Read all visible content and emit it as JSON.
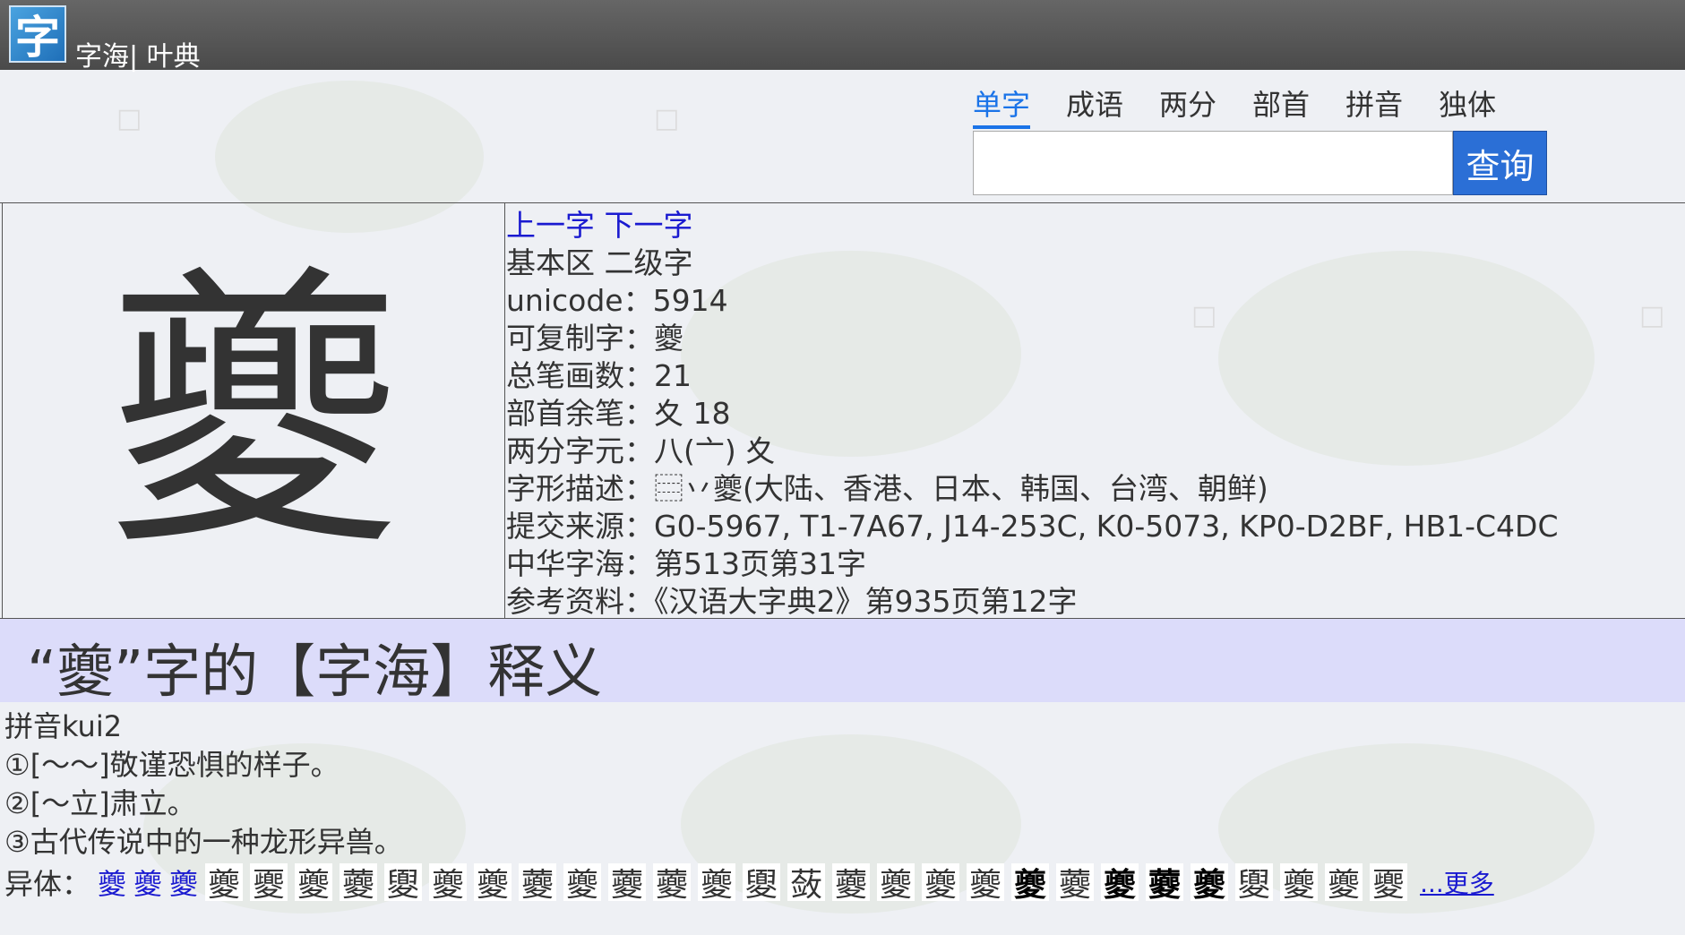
{
  "app": {
    "logo_char": "字",
    "title": "字海| 叶典"
  },
  "nav": {
    "tabs": [
      "单字",
      "成语",
      "两分",
      "部首",
      "拼音",
      "独体"
    ],
    "active_index": 0
  },
  "search": {
    "value": "",
    "placeholder": "",
    "button_label": "查询"
  },
  "character": {
    "glyph": "夔",
    "prev_link": "上一字",
    "next_link": "下一字",
    "lines": [
      "基本区 二级字",
      "unicode：5914",
      "可复制字：夔",
      "总笔画数：21",
      "部首余笔：夊 18",
      "两分字元：八(亠) 夊",
      "字形描述：⿳丷夔(大陆、香港、日本、韩国、台湾、朝鲜)",
      "提交来源：G0-5967, T1-7A67, J14-253C, K0-5073, KP0-D2BF, HB1-C4DC",
      "中华字海：第513页第31字",
      "参考资料：《汉语大字典2》第935页第12字"
    ]
  },
  "definition": {
    "title": "“夔”字的【字海】释义",
    "lines": [
      "拼音kui2",
      "①[～～]敬谨恐惧的样子。",
      "②[～立]肃立。",
      "③古代传说中的一种龙形异兽。"
    ]
  },
  "variants": {
    "label": "异体：",
    "links": [
      "夔",
      "夔",
      "夔"
    ],
    "images": [
      "夔",
      "夒",
      "夔",
      "蘷",
      "夓",
      "夔",
      "夔",
      "蘷",
      "夔",
      "蘷",
      "蘷",
      "夔",
      "夓",
      "蔹",
      "蘷",
      "夔",
      "夔",
      "夔",
      "夔",
      "蘷",
      "夔",
      "蘷",
      "夔",
      "夓",
      "夔",
      "夔",
      "夒"
    ],
    "more": "...更多"
  }
}
